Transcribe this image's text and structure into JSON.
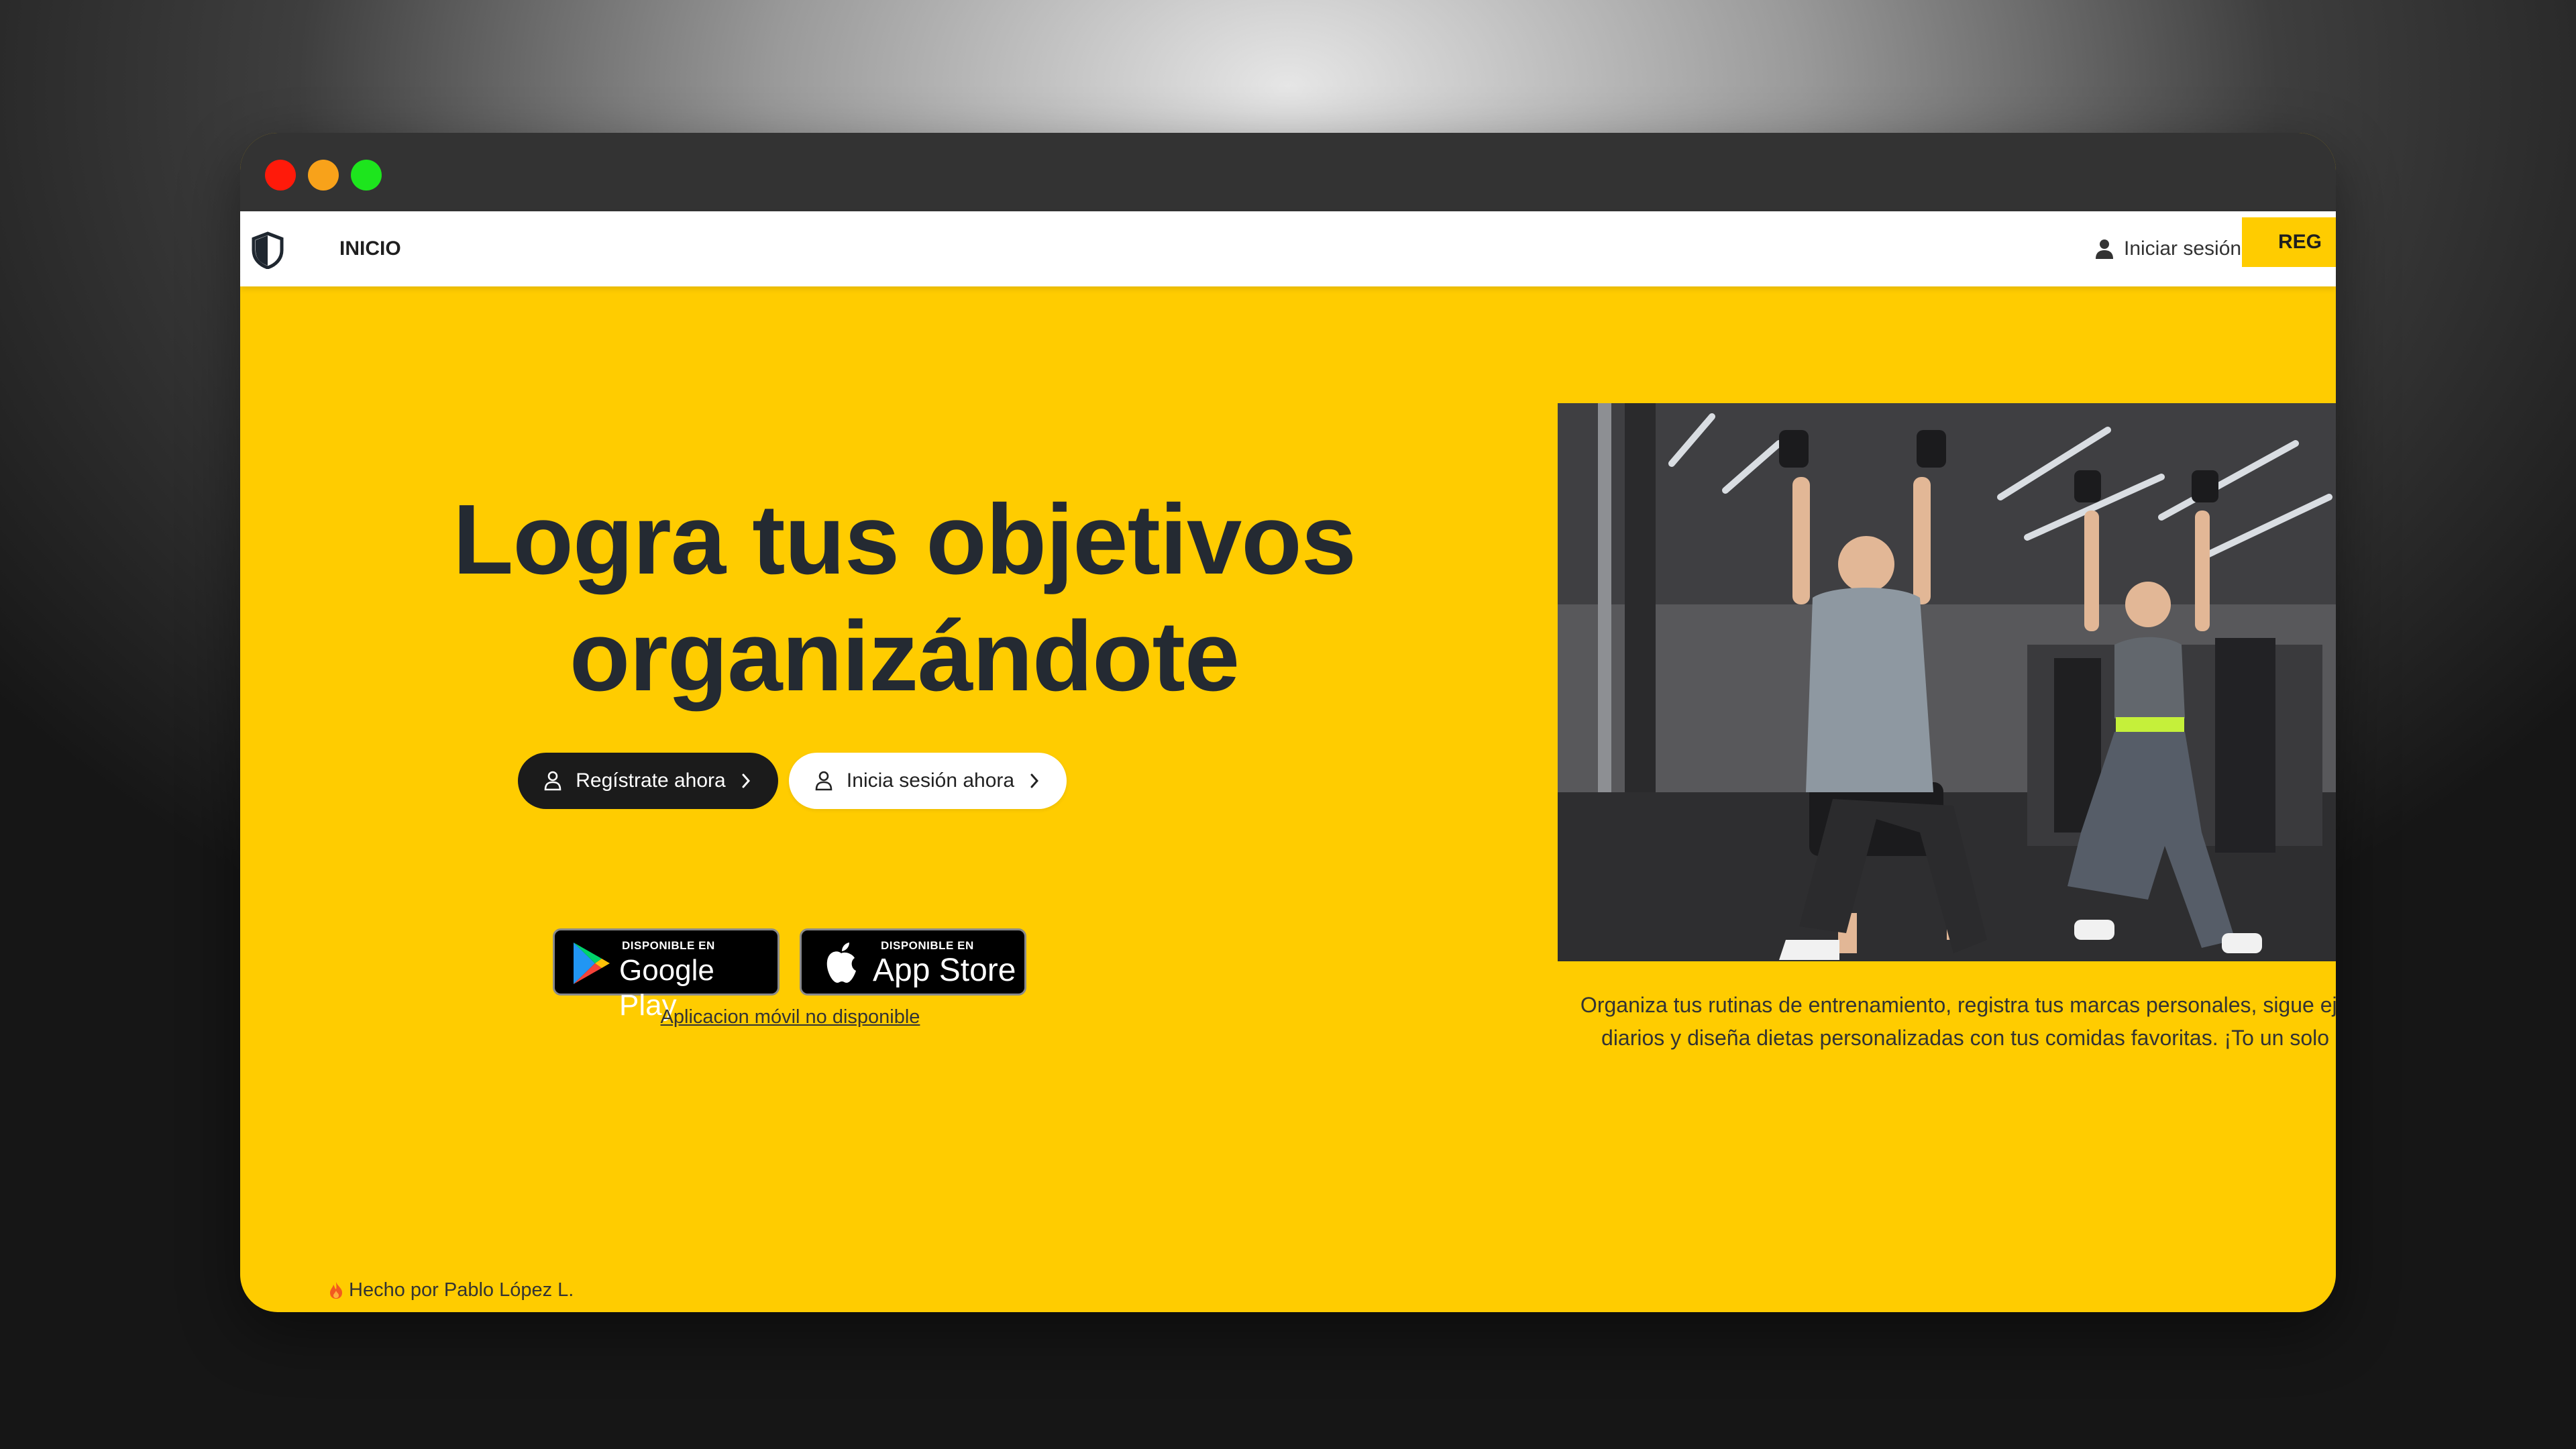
{
  "window": {
    "traffic_lights": {
      "close": "#ff1a0a",
      "minimize": "#f8a21a",
      "maximize": "#1de51d"
    }
  },
  "navbar": {
    "logo_icon": "shield-half-icon",
    "home_label": "INICIO",
    "login_icon": "user-icon",
    "login_label": "Iniciar sesión",
    "register_label": "REG"
  },
  "hero": {
    "title_line1": "Logra tus objetivos",
    "title_line2": "organizándote",
    "register_button": "Regístrate ahora",
    "login_button": "Inicia sesión ahora",
    "google_play": {
      "small": "DISPONIBLE EN",
      "big": "Google Play"
    },
    "app_store": {
      "small": "DISPONIBLE EN",
      "big": "App Store"
    },
    "mobile_note": "Aplicacion móvil no disponible",
    "image_icon": "gym-photo-icon",
    "description": "Organiza tus rutinas de entrenamiento, registra tus marcas personales, sigue ejercicios diarios y diseña dietas personalizadas con tus comidas favoritas. ¡To un solo lugar!"
  },
  "footer": {
    "icon": "flame-icon",
    "text": "Hecho por Pablo López L."
  },
  "colors": {
    "accent": "#ffcc00",
    "dark": "#1b1b1b",
    "title": "#242a32"
  }
}
